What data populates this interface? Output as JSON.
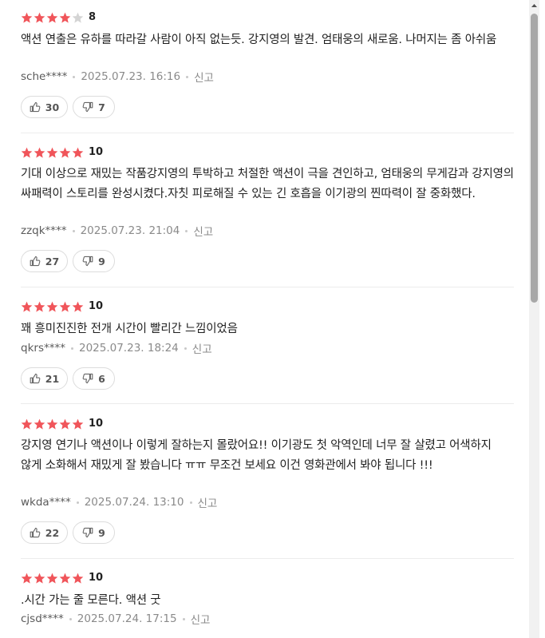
{
  "star_color_filled": "#f0555a",
  "star_color_empty": "#d4d4d4",
  "reviews": [
    {
      "stars_filled": 4,
      "score": "8",
      "content": "액션 연출은 유하를 따라갈 사람이 아직 없는듯. 강지영의 발견. 엄태웅의 새로움. 나머지는 좀 아쉬움",
      "user": "sche****",
      "date": "2025.07.23. 16:16",
      "report": "신고",
      "likes": "30",
      "dislikes": "7"
    },
    {
      "stars_filled": 5,
      "score": "10",
      "content": "기대 이상으로 재밌는 작품강지영의 투박하고 처절한 액션이 극을 견인하고, 엄태웅의 무게감과 강지영의 싸패력이 스토리를 완성시켰다.자칫 피로해질 수 있는 긴 호흡을 이기광의 찐따력이 잘 중화했다.",
      "user": "zzqk****",
      "date": "2025.07.23. 21:04",
      "report": "신고",
      "likes": "27",
      "dislikes": "9"
    },
    {
      "stars_filled": 5,
      "score": "10",
      "content": "꽤 흥미진진한 전개 시간이 빨리간 느낌이었음",
      "user": "qkrs****",
      "date": "2025.07.23. 18:24",
      "report": "신고",
      "likes": "21",
      "dislikes": "6"
    },
    {
      "stars_filled": 5,
      "score": "10",
      "content": "강지영 연기나 액션이나 이렇게 잘하는지 몰랐어요!! 이기광도 첫 악역인데 너무 잘 살렸고 어색하지 않게 소화해서 재밌게 잘 봤습니다 ㅠㅠ 무조건 보세요 이건 영화관에서 봐야 됩니다 !!!",
      "user": "wkda****",
      "date": "2025.07.24. 13:10",
      "report": "신고",
      "likes": "22",
      "dislikes": "9"
    },
    {
      "stars_filled": 5,
      "score": "10",
      "content": ".시간 가는 줄 모른다. 액션 굿",
      "user": "cjsd****",
      "date": "2025.07.24. 17:15",
      "report": "신고",
      "likes": "",
      "dislikes": ""
    }
  ]
}
